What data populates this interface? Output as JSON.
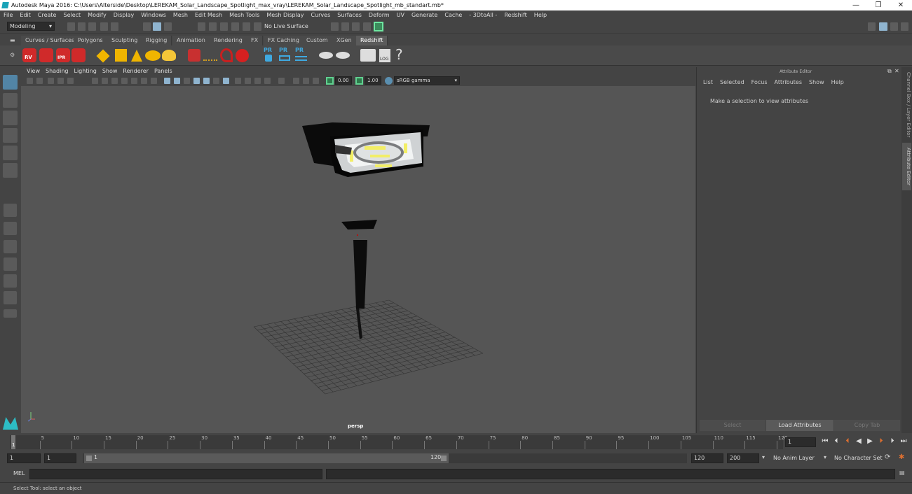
{
  "titlebar": {
    "title": "Autodesk Maya 2016: C:\\Users\\Alterside\\Desktop\\LEREKAM_Solar_Landscape_Spotlight_max_vray\\LEREKAM_Solar_Landscape_Spotlight_mb_standart.mb*",
    "minimize": "—",
    "restore": "❐",
    "close": "✕"
  },
  "menus": [
    "File",
    "Edit",
    "Create",
    "Select",
    "Modify",
    "Display",
    "Windows",
    "Mesh",
    "Edit Mesh",
    "Mesh Tools",
    "Mesh Display",
    "Curves",
    "Surfaces",
    "Deform",
    "UV",
    "Generate",
    "Cache",
    "- 3DtoAll -",
    "Redshift",
    "Help"
  ],
  "status": {
    "mode": "Modeling",
    "live_surface": "No Live Surface"
  },
  "shelf_tabs": [
    "Curves / Surfaces",
    "Polygons",
    "Sculpting",
    "Rigging",
    "Animation",
    "Rendering",
    "FX",
    "FX Caching",
    "Custom",
    "XGen",
    "Redshift"
  ],
  "shelf_active": "Redshift",
  "shelf_labels": {
    "rv": "RV",
    "ipr": "IPR",
    "pr": "PR",
    "log": "LOG",
    "help": "?"
  },
  "viewport": {
    "menus": [
      "View",
      "Shading",
      "Lighting",
      "Show",
      "Renderer",
      "Panels"
    ],
    "exposure": "0.00",
    "gamma": "1.00",
    "color_space": "sRGB gamma",
    "camera": "persp"
  },
  "attribute_editor": {
    "title": "Attribute Editor",
    "menus": [
      "List",
      "Selected",
      "Focus",
      "Attributes",
      "Show",
      "Help"
    ],
    "message": "Make a selection to view attributes",
    "buttons": [
      "Select",
      "Load Attributes",
      "Copy Tab"
    ]
  },
  "side_tabs": [
    "Channel Box / Layer Editor",
    "Attribute Editor"
  ],
  "timeline": {
    "ticks": [
      "1",
      "5",
      "10",
      "15",
      "20",
      "25",
      "30",
      "35",
      "40",
      "45",
      "50",
      "55",
      "60",
      "65",
      "70",
      "75",
      "80",
      "85",
      "90",
      "95",
      "100",
      "105",
      "110",
      "115",
      "120"
    ],
    "current_frame": "1"
  },
  "range": {
    "start": "1",
    "inner_start": "1",
    "slider_start": "1",
    "slider_end": "120",
    "end": "120",
    "outer_end": "200",
    "anim_layer": "No Anim Layer",
    "character_set": "No Character Set"
  },
  "cmdline": {
    "label": "MEL"
  },
  "helpline": {
    "text": "Select Tool: select an object"
  }
}
